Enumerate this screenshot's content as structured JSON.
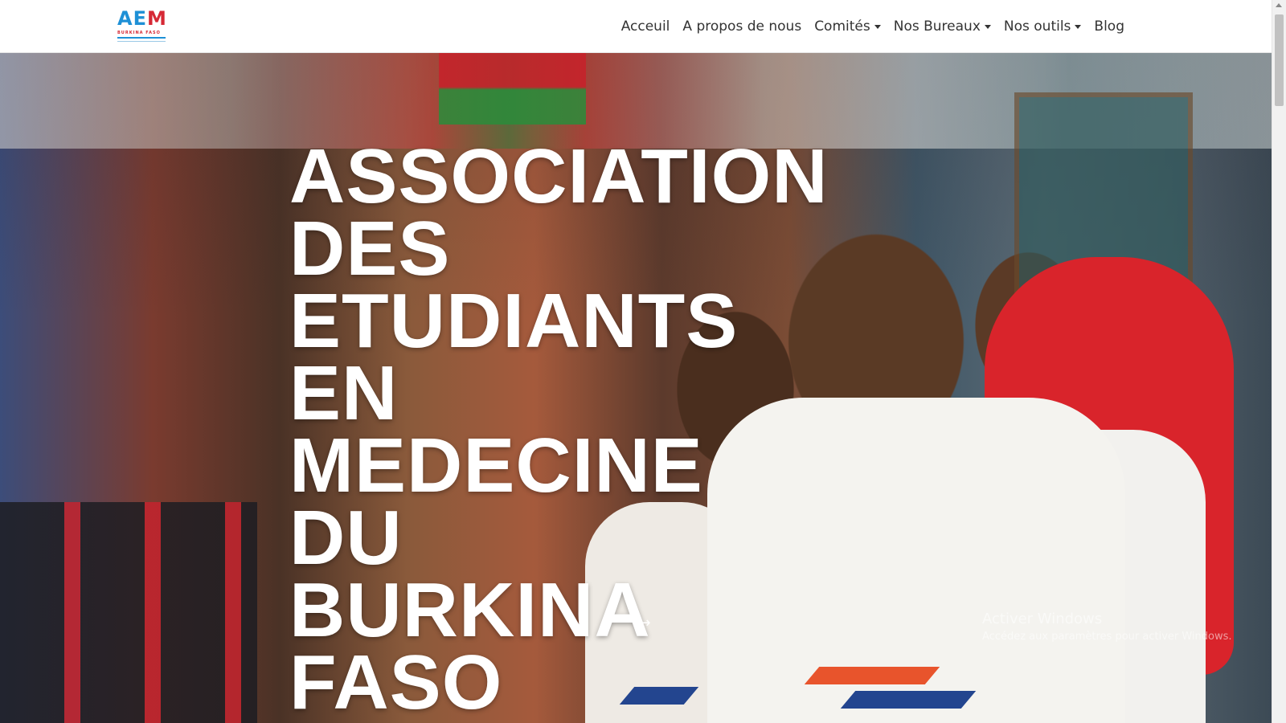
{
  "navbar": {
    "logo": {
      "mark_left": "AE",
      "mark_right": "M",
      "subtitle": "BURKINA FASO"
    },
    "links": [
      {
        "label": "Acceuil",
        "dropdown": false
      },
      {
        "label": "A propos de nous",
        "dropdown": false
      },
      {
        "label": "Comités",
        "dropdown": true
      },
      {
        "label": "Nos Bureaux",
        "dropdown": true
      },
      {
        "label": "Nos outils",
        "dropdown": true
      },
      {
        "label": "Blog",
        "dropdown": false
      }
    ]
  },
  "hero": {
    "title": "ASSOCIATION\nDES\nETUDIANTS\nEN\nMEDECINE\nDU\nBURKINA\nFASO",
    "next_arrow": "→"
  },
  "windows_activation": {
    "title": "Activer Windows",
    "subtitle": "Accédez aux paramètres pour activer Windows."
  },
  "icons": {
    "next": "arrow-right-icon",
    "dropdown": "caret-down-icon"
  },
  "colors": {
    "logo_blue": "#1e90d6",
    "logo_red": "#d62935",
    "nav_text": "#333333",
    "hero_text": "#ffffff"
  }
}
